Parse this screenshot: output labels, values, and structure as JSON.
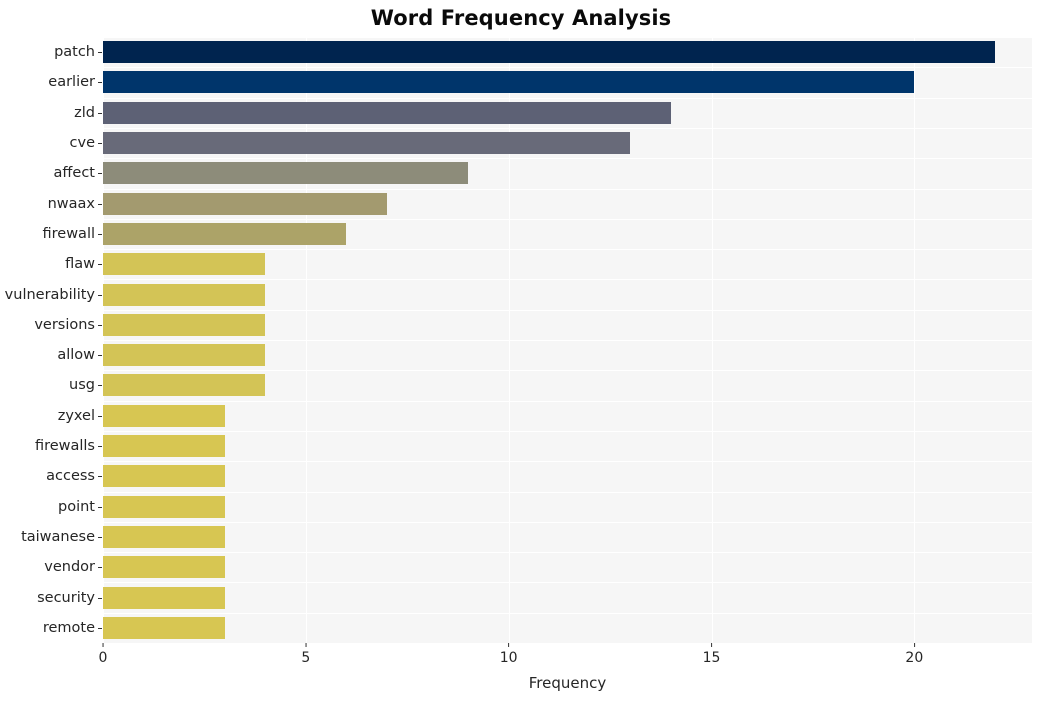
{
  "chart_data": {
    "type": "bar",
    "orientation": "horizontal",
    "title": "Word Frequency Analysis",
    "xlabel": "Frequency",
    "ylabel": "",
    "categories": [
      "patch",
      "earlier",
      "zld",
      "cve",
      "affect",
      "nwaax",
      "firewall",
      "flaw",
      "vulnerability",
      "versions",
      "allow",
      "usg",
      "zyxel",
      "firewalls",
      "access",
      "point",
      "taiwanese",
      "vendor",
      "security",
      "remote"
    ],
    "values": [
      22,
      20,
      14,
      13,
      9,
      7,
      6,
      4,
      4,
      4,
      4,
      4,
      3,
      3,
      3,
      3,
      3,
      3,
      3,
      3
    ],
    "bar_colors": [
      "#00244f",
      "#00356b",
      "#5d6175",
      "#686a79",
      "#8d8c7a",
      "#a39a6f",
      "#aca368",
      "#d3c456",
      "#d3c456",
      "#d3c456",
      "#d3c456",
      "#d3c456",
      "#d7c652",
      "#d7c652",
      "#d7c652",
      "#d7c652",
      "#d7c652",
      "#d7c652",
      "#d7c652",
      "#d7c652"
    ],
    "xlim": [
      0,
      22.9
    ],
    "xticks": [
      0,
      5,
      10,
      15,
      20
    ],
    "xtick_labels": [
      "0",
      "5",
      "10",
      "15",
      "20"
    ],
    "grid": true,
    "legend": false,
    "plot_background": "#f6f6f6",
    "figure_background": "#ffffff"
  }
}
